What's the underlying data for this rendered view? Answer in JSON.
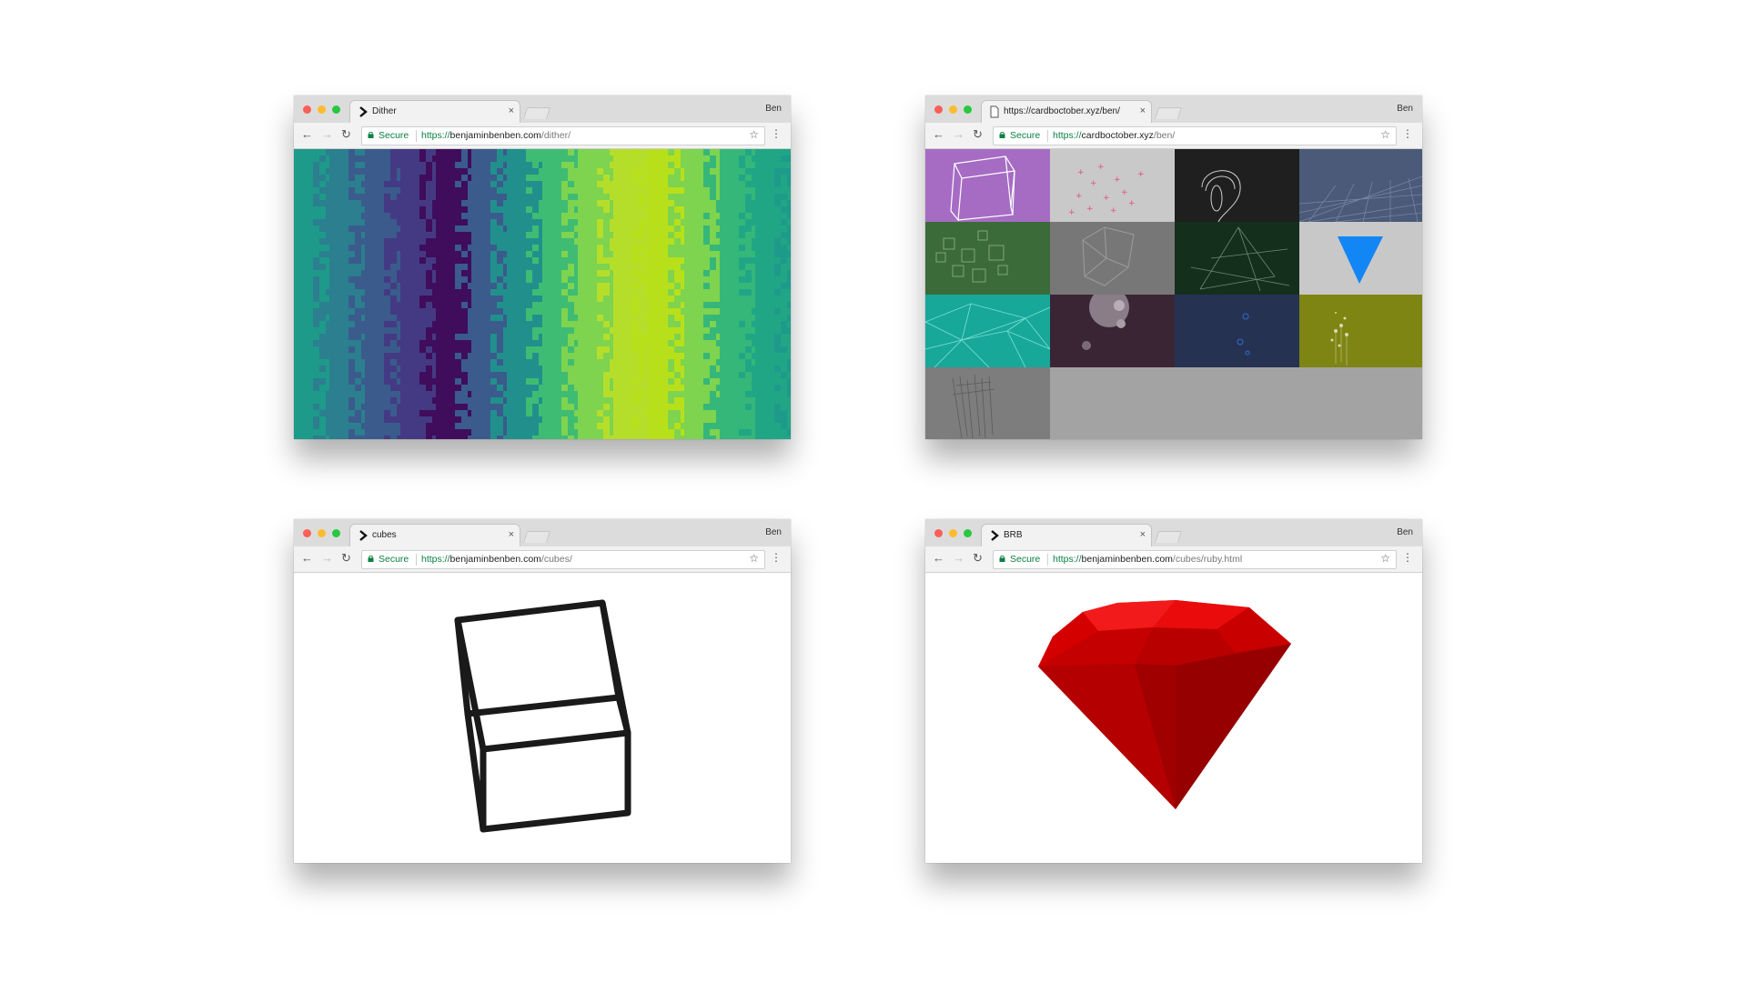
{
  "profile_name": "Ben",
  "windows": [
    {
      "tab_title": "Dither",
      "tab_icon": "terminal-prompt-icon",
      "secure_label": "Secure",
      "url": {
        "scheme": "https://",
        "host": "benjaminbenben.com",
        "path": "/dither/"
      }
    },
    {
      "tab_title": "https://cardboctober.xyz/ben/",
      "tab_icon": "page-icon",
      "secure_label": "Secure",
      "url": {
        "scheme": "https://",
        "host": "cardboctober.xyz",
        "path": "/ben/"
      }
    },
    {
      "tab_title": "cubes",
      "tab_icon": "terminal-prompt-icon",
      "secure_label": "Secure",
      "url": {
        "scheme": "https://",
        "host": "benjaminbenben.com",
        "path": "/cubes/"
      }
    },
    {
      "tab_title": "BRB",
      "tab_icon": "terminal-prompt-icon",
      "secure_label": "Secure",
      "url": {
        "scheme": "https://",
        "host": "benjaminbenben.com",
        "path": "/cubes/ruby.html"
      }
    }
  ],
  "colors": {
    "secure_green": "#0b8043",
    "dither_bands": [
      "#1e9a8a",
      "#2b7f8e",
      "#3a5b8c",
      "#443a83",
      "#3f0d5c",
      "#3a5b8c",
      "#21908c",
      "#3fbc73",
      "#7ed34f",
      "#b5de2b",
      "#b8e01a",
      "#7ed34f",
      "#35b779",
      "#21a685"
    ],
    "card_tiles": [
      "#a66cc4",
      "#c9c9c9",
      "#1f1f1f",
      "#4a5a78",
      "#3c6b3a",
      "#777777",
      "#14301c",
      "#c8c8c8",
      "#17a89a",
      "#3a2535",
      "#263252",
      "#7e8512",
      "#7d7d7d"
    ],
    "ruby": "#c40000",
    "cube_stroke": "#1a1a1a"
  }
}
